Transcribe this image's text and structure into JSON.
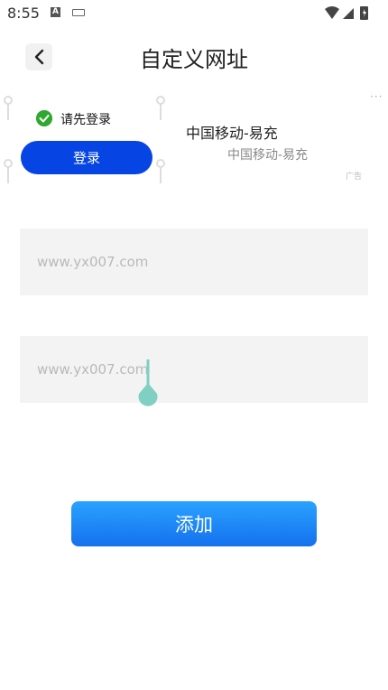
{
  "status_bar": {
    "time": "8:55",
    "a_badge": "A",
    "icons": [
      "keyboard-icon",
      "wifi-icon",
      "signal-icon",
      "battery-charging-icon"
    ]
  },
  "header": {
    "title": "自定义网址",
    "back_icon": "chevron-left-icon"
  },
  "ad": {
    "login_prompt": "请先登录",
    "login_button": "登录",
    "headline": "中国移动-易充",
    "subtitle": "中国移动-易充",
    "more": "···",
    "ad_tag": "广告",
    "colors": {
      "login_button": "#0645e4",
      "check": "#2fa82f"
    }
  },
  "form": {
    "url_input_1": {
      "value": "",
      "placeholder": "www.yx007.com"
    },
    "url_input_2": {
      "value": "",
      "placeholder": "www.yx007.com"
    },
    "add_button": "添加",
    "colors": {
      "add_button_top": "#2aa3ff",
      "add_button_bottom": "#1471ee",
      "cursor": "#7fcfc3"
    }
  }
}
